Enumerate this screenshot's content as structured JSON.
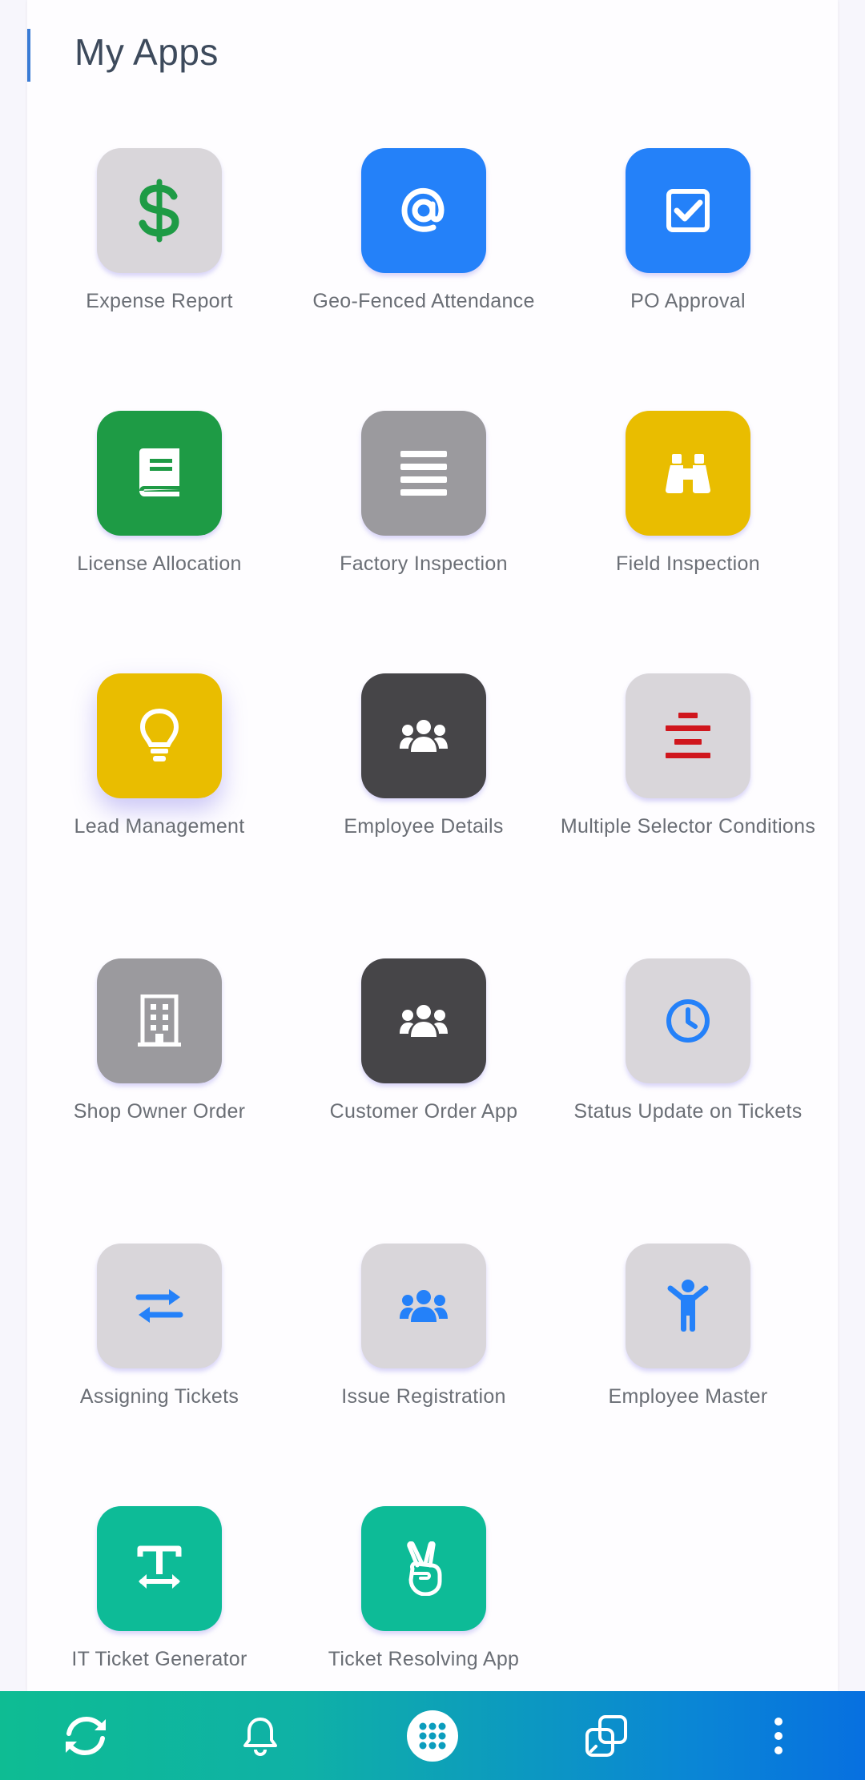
{
  "page": {
    "title": "My Apps"
  },
  "colors": {
    "tile_grey_light": "#d9d6da",
    "tile_blue": "#2481f9",
    "tile_green": "#1e9b45",
    "tile_grey": "#9b9a9e",
    "tile_yellow": "#e9bd00",
    "tile_dark": "#464548",
    "tile_teal": "#0dbb97",
    "nav_gradient_start": "#0ebc93",
    "nav_gradient_end": "#0770e0"
  },
  "apps": [
    {
      "label": "Expense Report",
      "icon": "dollar-icon",
      "tile_color": "#d9d6da",
      "icon_color": "#1e9b45"
    },
    {
      "label": "Geo-Fenced Attendance",
      "icon": "at-sign-icon",
      "tile_color": "#2481f9",
      "icon_color": "#ffffff"
    },
    {
      "label": "PO Approval",
      "icon": "checkbox-icon",
      "tile_color": "#2481f9",
      "icon_color": "#ffffff"
    },
    {
      "label": "License Allocation",
      "icon": "book-icon",
      "tile_color": "#1e9b45",
      "icon_color": "#ffffff"
    },
    {
      "label": "Factory Inspection",
      "icon": "list-lines-icon",
      "tile_color": "#9b9a9e",
      "icon_color": "#ffffff"
    },
    {
      "label": "Field Inspection",
      "icon": "binoculars-icon",
      "tile_color": "#e9bd00",
      "icon_color": "#ffffff"
    },
    {
      "label": "Lead Management",
      "icon": "lightbulb-icon",
      "tile_color": "#e9bd00",
      "icon_color": "#ffffff"
    },
    {
      "label": "Employee Details",
      "icon": "users-icon",
      "tile_color": "#464548",
      "icon_color": "#ffffff"
    },
    {
      "label": "Multiple Selector Conditions",
      "icon": "align-center-icon",
      "tile_color": "#d9d6da",
      "icon_color": "#d0161d"
    },
    {
      "label": "Shop Owner Order",
      "icon": "building-icon",
      "tile_color": "#9b9a9e",
      "icon_color": "#ffffff"
    },
    {
      "label": "Customer Order App",
      "icon": "users-icon",
      "tile_color": "#464548",
      "icon_color": "#ffffff"
    },
    {
      "label": "Status Update on Tickets",
      "icon": "clock-icon",
      "tile_color": "#d9d6da",
      "icon_color": "#2481f9"
    },
    {
      "label": "Assigning Tickets",
      "icon": "exchange-arrows-icon",
      "tile_color": "#d9d6da",
      "icon_color": "#2481f9"
    },
    {
      "label": "Issue Registration",
      "icon": "users-icon",
      "tile_color": "#d9d6da",
      "icon_color": "#2481f9"
    },
    {
      "label": "Employee Master",
      "icon": "person-arms-up-icon",
      "tile_color": "#d9d6da",
      "icon_color": "#2481f9"
    },
    {
      "label": "IT Ticket Generator",
      "icon": "text-width-icon",
      "tile_color": "#0dbb97",
      "icon_color": "#ffffff"
    },
    {
      "label": "Ticket Resolving App",
      "icon": "peace-hand-icon",
      "tile_color": "#0dbb97",
      "icon_color": "#ffffff"
    }
  ],
  "bottom_nav": {
    "items": [
      {
        "icon": "sync-icon"
      },
      {
        "icon": "bell-icon"
      },
      {
        "icon": "apps-grid-icon",
        "active": true
      },
      {
        "icon": "windows-icon"
      },
      {
        "icon": "more-vertical-icon"
      }
    ]
  }
}
